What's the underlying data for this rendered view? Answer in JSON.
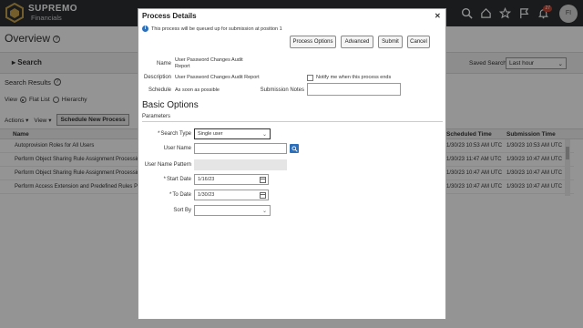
{
  "header": {
    "brand_name": "SUPREMO",
    "brand_sub": "Financials",
    "notification_count": "27",
    "avatar_initials": "FI"
  },
  "page": {
    "title": "Overview",
    "search_label": "Search",
    "saved_search_label": "Saved Search",
    "saved_search_value": "Last hour",
    "results_label": "Search Results",
    "view_label": "View",
    "flat_list": "Flat List",
    "hierarchy": "Hierarchy",
    "actions": "Actions",
    "view_menu": "View",
    "schedule_new": "Schedule New Process",
    "columns": {
      "name": "Name",
      "scheduled": "Scheduled Time",
      "submission": "Submission Time"
    },
    "rows": [
      {
        "name": "Autoprovision Roles for All Users",
        "scheduled": "1/30/23 10:53 AM UTC",
        "submission": "1/30/23 10:53 AM UTC"
      },
      {
        "name": "Perform Object Sharing Rule Assignment Processing",
        "scheduled": "1/30/23 11:47 AM UTC",
        "submission": "1/30/23 10:47 AM UTC"
      },
      {
        "name": "Perform Object Sharing Rule Assignment Processing",
        "scheduled": "1/30/23 10:47 AM UTC",
        "submission": "1/30/23 10:47 AM UTC"
      },
      {
        "name": "Perform Access Extension and Predefined Rules Proc",
        "scheduled": "1/30/23 10:47 AM UTC",
        "submission": "1/30/23 10:47 AM UTC"
      }
    ]
  },
  "dialog": {
    "title": "Process Details",
    "close": "✕",
    "info": "This process will be queued up for submission at position 1",
    "buttons": {
      "process_options": "Process Options",
      "advanced": "Advanced",
      "submit": "Submit",
      "cancel": "Cancel"
    },
    "name_label": "Name",
    "name_value": "User Password Changes Audit Report",
    "description_label": "Description",
    "description_value": "User Password Changes Audit Report",
    "notify_label": "Notify me when this process ends",
    "schedule_label": "Schedule",
    "schedule_value": "As soon as possible",
    "submission_notes_label": "Submission Notes",
    "basic_options": "Basic Options",
    "parameters": "Parameters",
    "search_type_label": "Search Type",
    "search_type_value": "Single user",
    "user_name_label": "User Name",
    "user_name_pattern_label": "User Name Pattern",
    "start_date_label": "Start Date",
    "start_date_value": "1/16/23",
    "to_date_label": "To Date",
    "to_date_value": "1/30/23",
    "sort_by_label": "Sort By"
  }
}
